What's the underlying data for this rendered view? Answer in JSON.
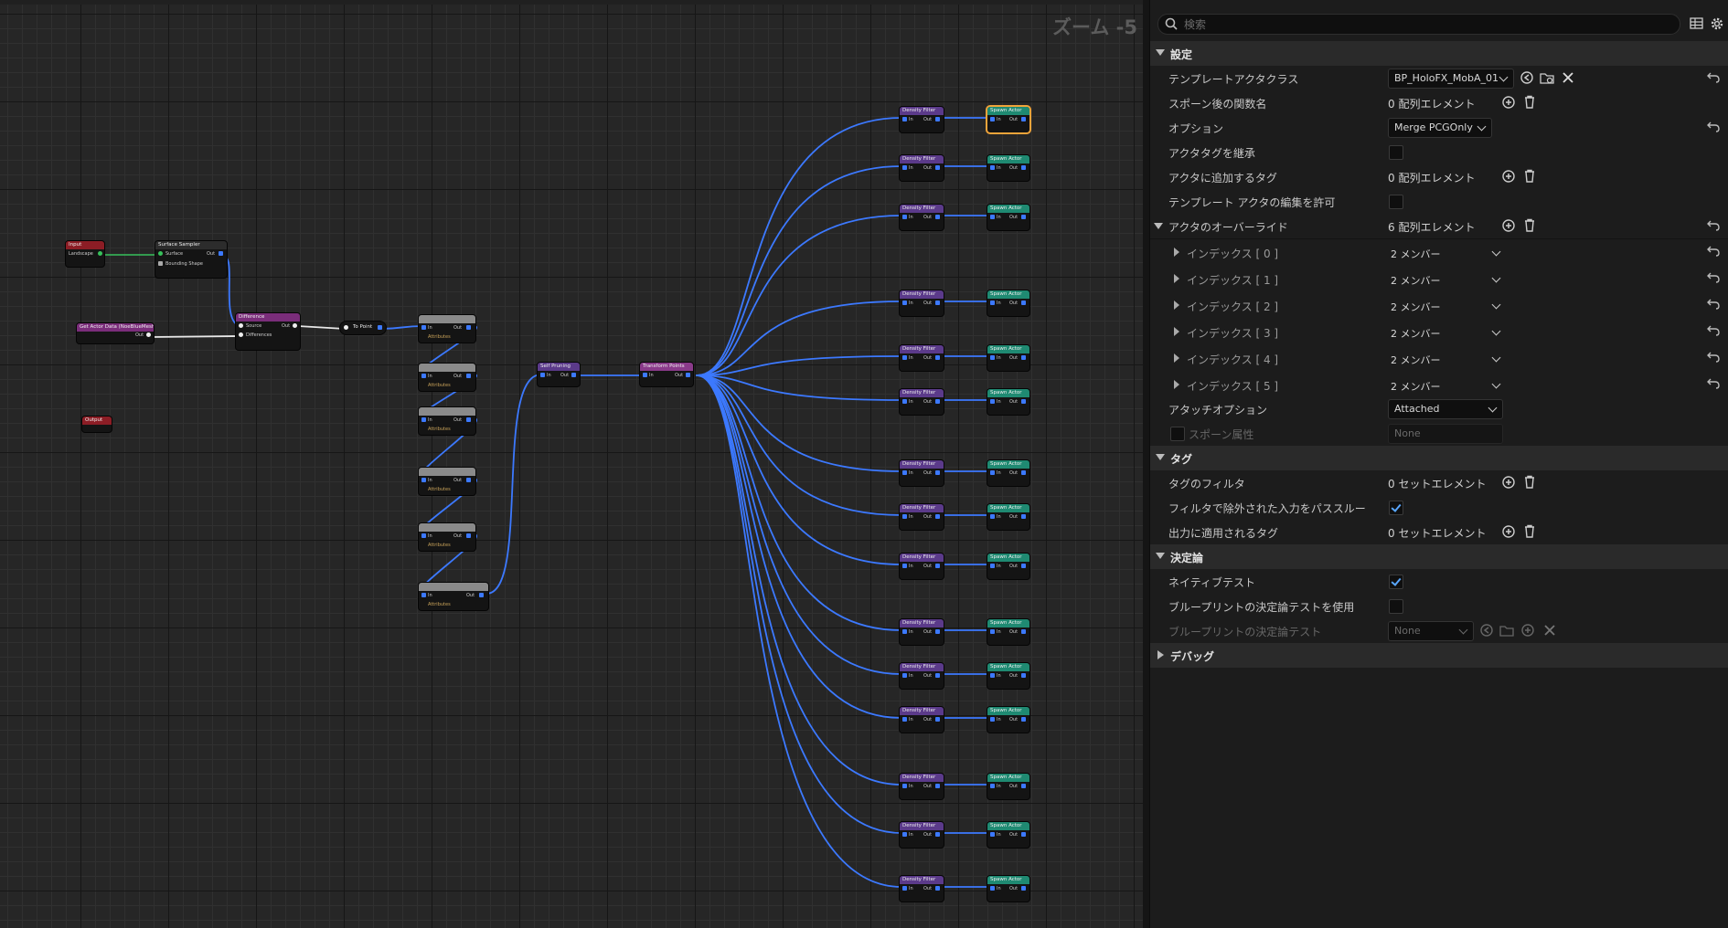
{
  "graph": {
    "zoom_label": "ズーム -5",
    "nodes": {
      "input": {
        "title": "Input",
        "pin": "Landscape"
      },
      "surface_sampler": {
        "title": "Surface Sampler",
        "pin_surface": "Surface",
        "pin_bounding": "Bounding Shape",
        "pin_out": "Out"
      },
      "get_actor_data": {
        "title": "Get Actor Data (NoeBlueMesh)",
        "pin_out": "Out"
      },
      "difference": {
        "title": "Difference",
        "pin_source": "Source",
        "pin_diff": "Differences",
        "pin_out": "Out"
      },
      "to_point": {
        "title": "To Point"
      },
      "output": {
        "title": "Output"
      },
      "self_pruning": {
        "title": "Self Pruning",
        "pin_in": "In",
        "pin_out": "Out"
      },
      "transform_points": {
        "title": "Transform Points",
        "pin_in": "In",
        "pin_out": "Out"
      },
      "mid_pin_in": "In",
      "mid_pin_out": "Out",
      "mid_pin_attr": "Attributes",
      "filter_title": "Density Filter",
      "spawn_title": "Spawn Actor",
      "filter_pin_in": "In",
      "filter_pin_out": "Out"
    }
  },
  "panel": {
    "search": {
      "placeholder": "検索"
    },
    "sections": {
      "settings": "設定",
      "tags": "タグ",
      "determinism": "決定論",
      "debug": "デバッグ"
    },
    "rows": {
      "template_class": {
        "label": "テンプレートアクタクラス",
        "value": "BP_HoloFX_MobA_01"
      },
      "post_spawn_func": {
        "label": "スポーン後の関数名",
        "value": "0 配列エレメント"
      },
      "option": {
        "label": "オプション",
        "value": "Merge PCGOnly"
      },
      "inherit_tags": {
        "label": "アクタタグを継承"
      },
      "tags_to_add": {
        "label": "アクタに追加するタグ",
        "value": "0 配列エレメント"
      },
      "allow_template_edit": {
        "label": "テンプレート アクタの編集を許可"
      },
      "actor_overrides": {
        "label": "アクタのオーバーライド",
        "value": "6 配列エレメント"
      },
      "index": [
        {
          "label": "インデックス [ 0 ]",
          "value": "2 メンバー"
        },
        {
          "label": "インデックス [ 1 ]",
          "value": "2 メンバー"
        },
        {
          "label": "インデックス [ 2 ]",
          "value": "2 メンバー"
        },
        {
          "label": "インデックス [ 3 ]",
          "value": "2 メンバー"
        },
        {
          "label": "インデックス [ 4 ]",
          "value": "2 メンバー"
        },
        {
          "label": "インデックス [ 5 ]",
          "value": "2 メンバー"
        }
      ],
      "attach_option": {
        "label": "アタッチオプション",
        "value": "Attached"
      },
      "spawn_attr": {
        "label": "スポーン属性",
        "value": "None"
      },
      "tag_filter": {
        "label": "タグのフィルタ",
        "value": "0 セットエレメント"
      },
      "pass_through": {
        "label": "フィルタで除外された入力をパススルー"
      },
      "output_tags": {
        "label": "出力に適用されるタグ",
        "value": "0 セットエレメント"
      },
      "native_test": {
        "label": "ネイティブテスト"
      },
      "use_bp_test": {
        "label": "ブループリントの決定論テストを使用"
      },
      "bp_test": {
        "label": "ブループリントの決定論テスト",
        "value": "None"
      }
    }
  }
}
